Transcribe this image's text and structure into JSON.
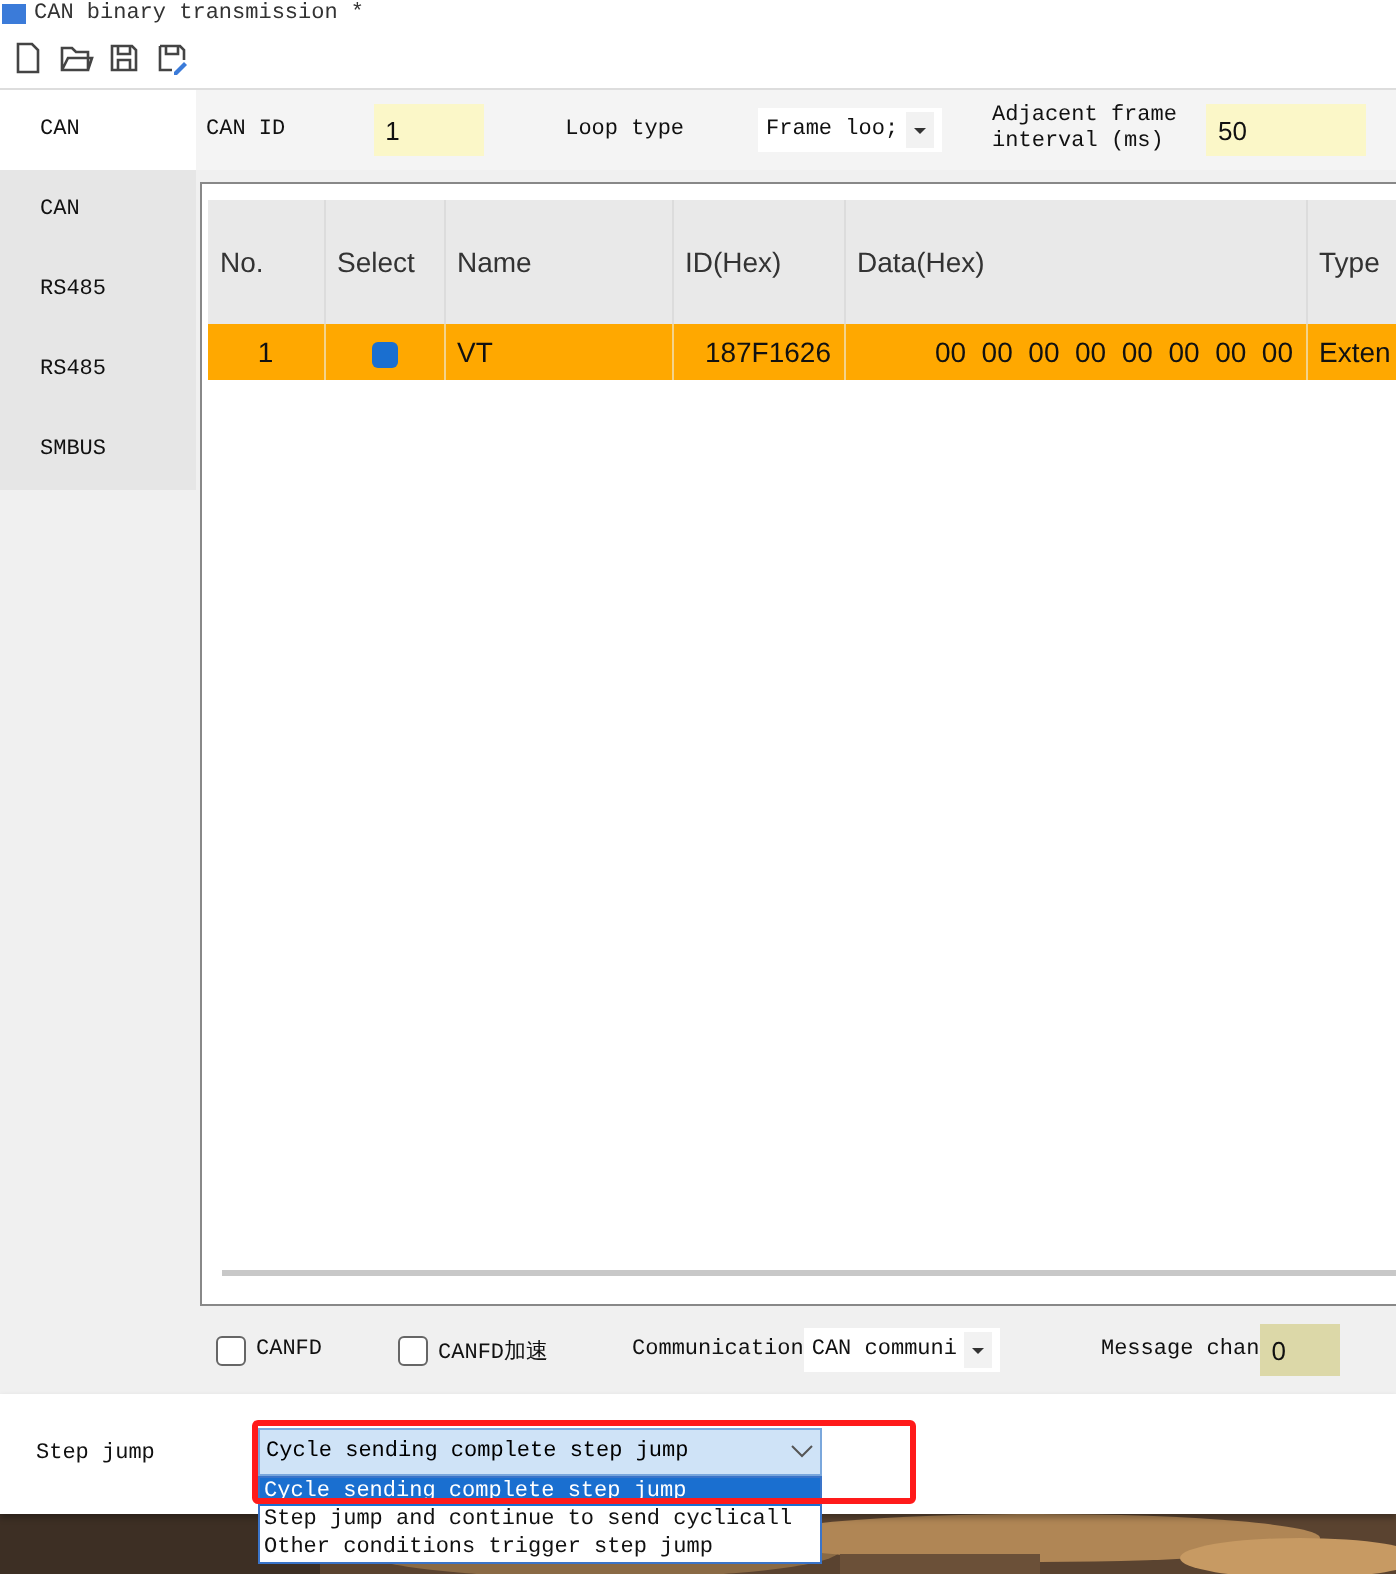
{
  "window": {
    "title": "CAN binary transmission *"
  },
  "toolbar": [
    {
      "kind": "new"
    },
    {
      "kind": "open"
    },
    {
      "kind": "save"
    },
    {
      "kind": "save-as"
    }
  ],
  "sidebar": {
    "items": [
      {
        "label": "CAN",
        "selected": true
      },
      {
        "label": "CAN",
        "selected": false
      },
      {
        "label": "RS485",
        "selected": false
      },
      {
        "label": "RS485",
        "selected": false
      },
      {
        "label": "SMBUS",
        "selected": false
      }
    ]
  },
  "settings": {
    "can_id_label": "CAN ID",
    "can_id": "1",
    "loop_type_label": "Loop type",
    "loop_type": "Frame loo;",
    "interval_label": "Adjacent frame interval (ms)",
    "interval": "50"
  },
  "table": {
    "columns": [
      "No.",
      "Select",
      "Name",
      "ID(Hex)",
      "Data(Hex)",
      "Type"
    ],
    "rows": [
      {
        "no": "1",
        "checked": true,
        "name": "VT",
        "id": "187F1626",
        "data": "00  00  00  00  00  00  00  00",
        "type": "Exten",
        "selected": true
      }
    ]
  },
  "options": {
    "canfd": {
      "label": "CANFD",
      "checked": false
    },
    "canfd_accel": {
      "label": "CANFD加速",
      "checked": false
    },
    "communication_label": "Communication",
    "communication": "CAN communi",
    "message_label": "Message chan",
    "message": "0"
  },
  "step_jump": {
    "label": "Step jump",
    "value": "Cycle sending complete step jump",
    "expanded": true,
    "options": [
      {
        "label": "Cycle sending complete step jump",
        "selected": true
      },
      {
        "label": "Step jump and continue to send cyclicall",
        "selected": false
      },
      {
        "label": "Other conditions trigger step jump",
        "selected": false
      }
    ]
  }
}
